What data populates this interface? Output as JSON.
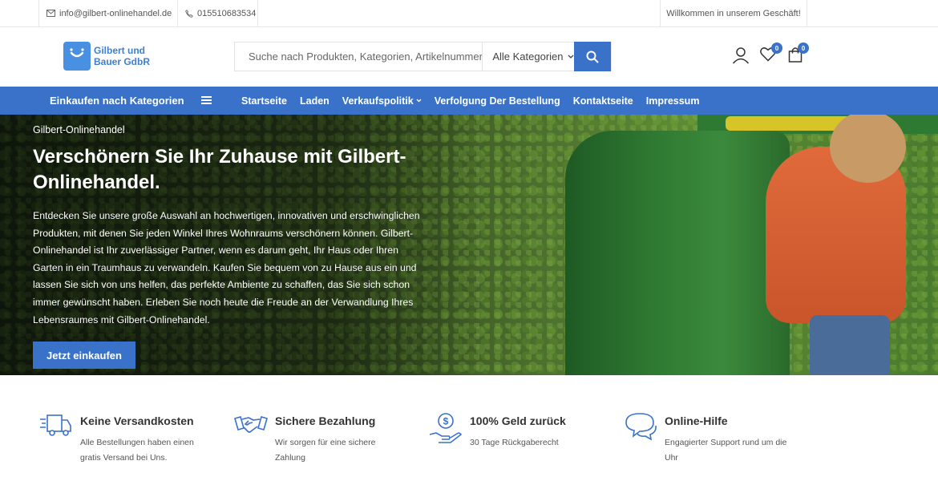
{
  "topbar": {
    "email": "info@gilbert-onlinehandel.de",
    "phone": "015510683534",
    "welcome": "Willkommen in unserem Geschäft!"
  },
  "header": {
    "logo_line1": "Gilbert und",
    "logo_line2": "Bauer GdbR",
    "search_placeholder": "Suche nach Produkten, Kategorien, Artikelnummern",
    "category_selected": "Alle Kategorien",
    "wishlist_count": "0",
    "cart_count": "0"
  },
  "nav": {
    "categories_label": "Einkaufen nach Kategorien",
    "links": [
      "Startseite",
      "Laden",
      "Verkaufspolitik",
      "Verfolgung Der Bestellung",
      "Kontaktseite",
      "Impressum"
    ]
  },
  "hero": {
    "subtitle": "Gilbert-Onlinehandel",
    "title": "Verschönern Sie Ihr Zuhause mit Gilbert-Onlinehandel.",
    "text": "Entdecken Sie unsere große Auswahl an hochwertigen, innovativen und erschwinglichen Produkten, mit denen Sie jeden Winkel Ihres Wohnraums verschönern können. Gilbert-Onlinehandel ist Ihr zuverlässiger Partner, wenn es darum geht, Ihr Haus oder Ihren Garten in ein Traumhaus zu verwandeln. Kaufen Sie bequem von zu Hause aus ein und lassen Sie sich von uns helfen, das perfekte Ambiente zu schaffen, das Sie sich schon immer gewünscht haben. Erleben Sie noch heute die Freude an der Verwandlung Ihres Lebensraumes mit Gilbert-Onlinehandel.",
    "button": "Jetzt einkaufen"
  },
  "features": [
    {
      "icon": "truck-icon",
      "title": "Keine Versandkosten",
      "text": "Alle Bestellungen haben einen gratis Versand bei Uns."
    },
    {
      "icon": "handshake-icon",
      "title": "Sichere Bezahlung",
      "text": "Wir sorgen für eine sichere Zahlung"
    },
    {
      "icon": "money-back-icon",
      "title": "100% Geld zurück",
      "text": "30 Tage Rückgaberecht"
    },
    {
      "icon": "chat-icon",
      "title": "Online-Hilfe",
      "text": "Engagierter Support rund um die Uhr"
    }
  ],
  "colors": {
    "accent": "#3a72c9",
    "logo": "#4a90e2"
  }
}
